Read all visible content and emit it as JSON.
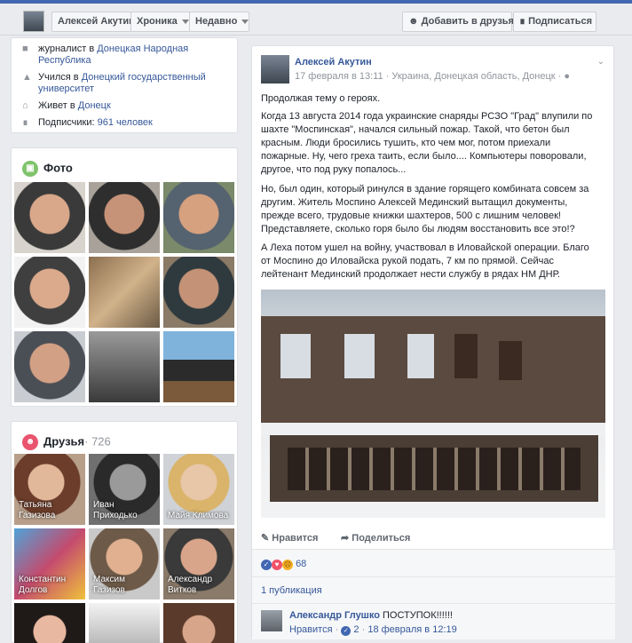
{
  "topbar": {
    "name": "Алексей Акутин",
    "chronicle": "Хроника",
    "recent": "Недавно",
    "add_friend": "Добавить в друзья",
    "subscribe": "Подписаться"
  },
  "intro": {
    "journalist_prefix": "журналист в",
    "journalist_link": "Донецкая Народная Республика",
    "studied_prefix": "Учился в",
    "studied_link": "Донецкий государственный университет",
    "lives_prefix": "Живет в",
    "lives_link": "Донецк",
    "followers_prefix": "Подписчики:",
    "followers_link": "961 человек"
  },
  "photos": {
    "title": "Фото"
  },
  "friends": {
    "title": "Друзья",
    "count": "· 726",
    "items": [
      {
        "first": "Татьяна",
        "last": "Газизова"
      },
      {
        "first": "Иван",
        "last": "Приходько"
      },
      {
        "first": "Майя Климова",
        "last": ""
      },
      {
        "first": "Константин",
        "last": "Долгов"
      },
      {
        "first": "Максим",
        "last": "Газизов"
      },
      {
        "first": "Александр",
        "last": "Витков"
      }
    ]
  },
  "post": {
    "author": "Алексей Акутин",
    "date": "17 февраля в 13:11",
    "location": "· Украина, Донецкая область, Донецк ·",
    "p1": "Продолжая тему о героях.",
    "p2": "Когда 13 августа 2014 года украинские снаряды РСЗО \"Град\" влупили по шахте \"Моспинская\", начался сильный пожар. Такой, что бетон был красным. Люди бросились тушить, кто чем мог, потом приехали пожарные. Ну, чего греха таить, если было.... Компьютеры поворовали, другое, что под руку попалось...",
    "p3": "Но, был один, который ринулся в здание горящего комбината совсем за другим. Житель Моспино Алексей Мединский вытащил документы, прежде всего, трудовые книжки шахтеров, 500 с лишним человек! Представляете, сколько горя было бы людям восстановить все это!?",
    "p4": "А Леха потом ушел на войну, участвовал в Иловайской операции. Благо от Моспино до Иловайска рукой подать, 7 км по прямой. Сейчас лейтенант Мединский продолжает нести службу в рядах НМ ДНР.",
    "like": "Нравится",
    "share": "Поделиться",
    "reactions_count": "68",
    "shares": "1 публикация",
    "comment_author": "Александр Глушко",
    "comment_text": "ПОСТУПОК!!!!!!",
    "comment_like": "Нравится",
    "comment_likes": "2",
    "comment_date": "18 февраля в 12:19"
  }
}
